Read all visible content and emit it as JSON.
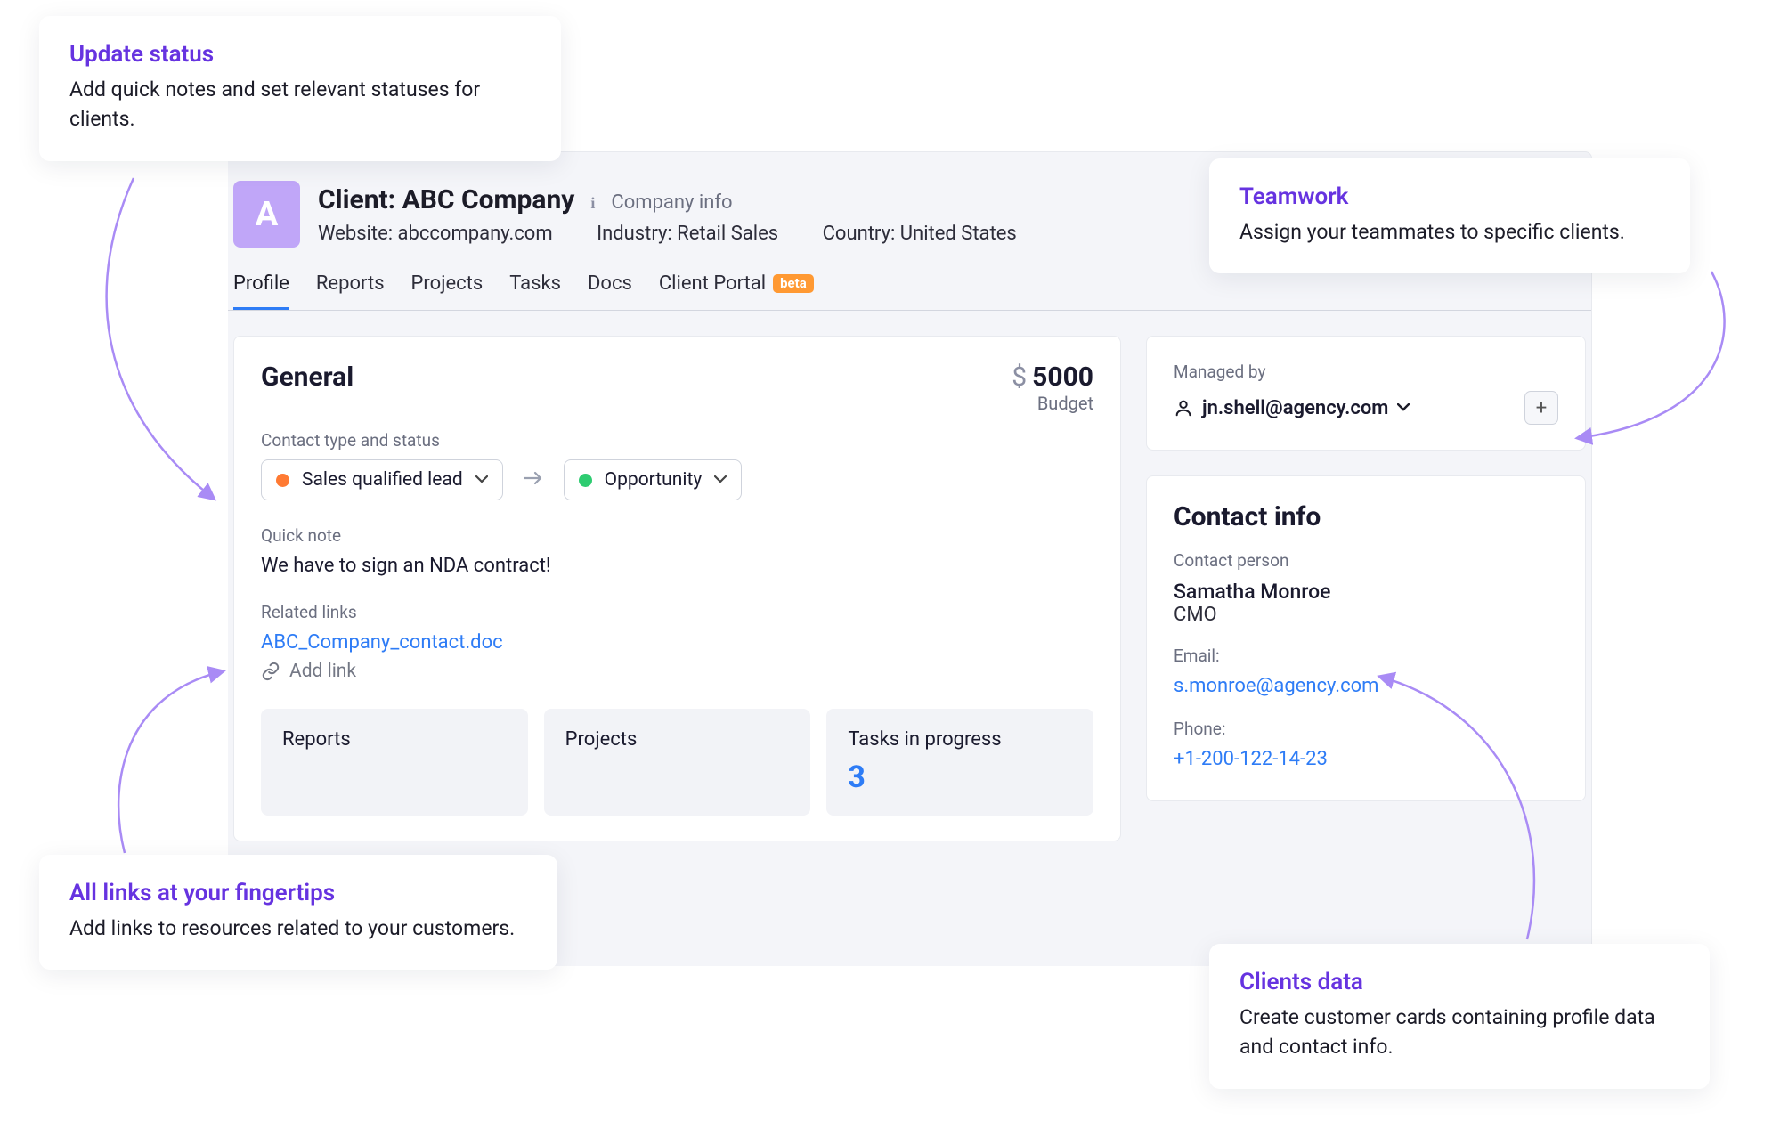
{
  "callouts": {
    "update": {
      "title": "Update status",
      "text": "Add quick notes and set relevant statuses for clients."
    },
    "teamwork": {
      "title": "Teamwork",
      "text": "Assign your teammates to specific clients."
    },
    "links": {
      "title": "All links at your fingertips",
      "text": "Add links to resources related to your customers."
    },
    "clients": {
      "title": "Clients data",
      "text": "Create customer cards containing profile data and contact info."
    }
  },
  "header": {
    "avatar_letter": "A",
    "title": "Client: ABC Company",
    "company_info_label": "Company info",
    "website_label": "Website: abccompany.com",
    "industry_label": "Industry: Retail Sales",
    "country_label": "Country: United States"
  },
  "tabs": {
    "profile": "Profile",
    "reports": "Reports",
    "projects": "Projects",
    "tasks": "Tasks",
    "docs": "Docs",
    "client_portal": "Client Portal",
    "beta": "beta"
  },
  "general": {
    "title": "General",
    "budget_value": "5000",
    "budget_label": "Budget",
    "status_label": "Contact type and status",
    "status_from": "Sales qualified lead",
    "status_to": "Opportunity",
    "note_label": "Quick note",
    "note_text": "We have to sign an NDA contract!",
    "related_label": "Related links",
    "related_link": "ABC_Company_contact.doc",
    "add_link_label": "Add link"
  },
  "stats": {
    "reports": {
      "title": "Reports"
    },
    "projects": {
      "title": "Projects"
    },
    "tasks": {
      "title": "Tasks in progress",
      "value": "3"
    }
  },
  "managed": {
    "label": "Managed by",
    "manager": "jn.shell@agency.com"
  },
  "contact": {
    "title": "Contact info",
    "person_label": "Contact person",
    "name": "Samatha Monroe",
    "role": "CMO",
    "email_label": "Email:",
    "email": "s.monroe@agency.com",
    "phone_label": "Phone:",
    "phone": "+1-200-122-14-23"
  }
}
